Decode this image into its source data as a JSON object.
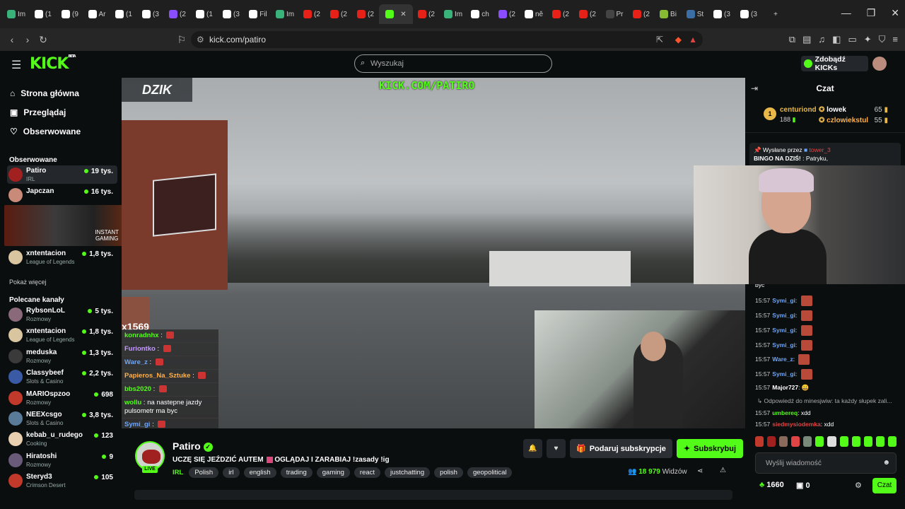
{
  "browser": {
    "tabs": [
      {
        "label": "Im",
        "color": "#3ab37a"
      },
      {
        "label": "(1",
        "color": "#ffffff"
      },
      {
        "label": "(9",
        "color": "#ffffff"
      },
      {
        "label": "Ar",
        "color": "#ffffff"
      },
      {
        "label": "(1",
        "color": "#ffffff"
      },
      {
        "label": "(3",
        "color": "#ffffff"
      },
      {
        "label": "(2",
        "color": "#8a4dff"
      },
      {
        "label": "(1",
        "color": "#ffffff"
      },
      {
        "label": "(3",
        "color": "#ffffff"
      },
      {
        "label": "Fil",
        "color": "#ffffff"
      },
      {
        "label": "Im",
        "color": "#3ab37a"
      },
      {
        "label": "(2",
        "color": "#e62117"
      },
      {
        "label": "(2",
        "color": "#e62117"
      },
      {
        "label": "(2",
        "color": "#e62117"
      },
      {
        "label": "",
        "color": "#53fc18"
      },
      {
        "label": "(2",
        "color": "#e62117"
      },
      {
        "label": "Im",
        "color": "#3ab37a"
      },
      {
        "label": "ch",
        "color": "#ffffff"
      },
      {
        "label": "(2",
        "color": "#8a4dff"
      },
      {
        "label": "ně",
        "color": "#ffffff"
      },
      {
        "label": "(2",
        "color": "#e62117"
      },
      {
        "label": "(2",
        "color": "#e62117"
      },
      {
        "label": "Pr",
        "color": "#444444"
      },
      {
        "label": "(2",
        "color": "#e62117"
      },
      {
        "label": "Bi",
        "color": "#88bb33"
      },
      {
        "label": "St",
        "color": "#3b6ea5"
      },
      {
        "label": "(3",
        "color": "#ffffff"
      },
      {
        "label": "(3",
        "color": "#ffffff"
      }
    ],
    "url": "kick.com/patiro"
  },
  "header": {
    "logo": "KICK",
    "logo_beta": "BETA",
    "search_placeholder": "Wyszukaj",
    "kicks_button": "Zdobądź KICKs"
  },
  "sidebar": {
    "nav": [
      {
        "label": "Strona główna",
        "icon": "⌂"
      },
      {
        "label": "Przeglądaj",
        "icon": "▣"
      },
      {
        "label": "Obserwowane",
        "icon": "♡"
      }
    ],
    "followed_heading": "Obserwowane",
    "followed": [
      {
        "name": "Patiro",
        "category": "IRL",
        "viewers": "19 tys.",
        "avatar": "#a12020"
      },
      {
        "name": "Japczan",
        "category": "",
        "viewers": "16 tys.",
        "avatar": "#c98a7a"
      },
      {
        "name": "xntentacion",
        "category": "League of Legends",
        "viewers": "1,8 tys.",
        "avatar": "#d9c6a0"
      }
    ],
    "ad_text_1": "INSTANT",
    "ad_text_2": "GAMING",
    "show_more": "Pokaż więcej",
    "recommended_heading": "Polecane kanały",
    "recommended": [
      {
        "name": "RybsonLoL",
        "category": "Rozmowy",
        "viewers": "5 tys.",
        "avatar": "#8a6a7a"
      },
      {
        "name": "xntentacion",
        "category": "League of Legends",
        "viewers": "1,8 tys.",
        "avatar": "#d9c6a0"
      },
      {
        "name": "meduska",
        "category": "Rozmowy",
        "viewers": "1,3 tys.",
        "avatar": "#3a3a3a"
      },
      {
        "name": "Classybeef",
        "category": "Slots & Casino",
        "viewers": "2,2 tys.",
        "avatar": "#3b5aa5"
      },
      {
        "name": "MARIOspzoo",
        "category": "Rozmowy",
        "viewers": "698",
        "avatar": "#c0392b"
      },
      {
        "name": "NEEXcsgo",
        "category": "Slots & Casino",
        "viewers": "3,8 tys.",
        "avatar": "#5a7a9a"
      },
      {
        "name": "kebab_u_rudego",
        "category": "Cooking",
        "viewers": "123",
        "avatar": "#e8d0b0"
      },
      {
        "name": "Hiratoshi",
        "category": "Rozmowy",
        "viewers": "9",
        "avatar": "#6a5a7a"
      },
      {
        "name": "Steryd3",
        "category": "Crimson Desert",
        "viewers": "105",
        "avatar": "#c0392b"
      }
    ]
  },
  "video": {
    "logo": "DZIK",
    "overlay_url": "KICK.COM/PATIRO",
    "cam_number": "x1569",
    "chat": [
      {
        "user": "konradnhx",
        "text": "",
        "color": "#53fc18"
      },
      {
        "user": "Furiontko",
        "text": "",
        "color": "#c59bff"
      },
      {
        "user": "Ware_z",
        "text": "",
        "color": "#6aa6ff"
      },
      {
        "user": "Papieros_Na_Sztuke",
        "text": "",
        "color": "#ffb14a"
      },
      {
        "user": "bbs2020",
        "text": "",
        "color": "#53fc18"
      },
      {
        "user": "wollu",
        "text": "na nastepne jazdy pulsometr ma byc",
        "color": "#53fc18"
      },
      {
        "user": "Symi_gi",
        "text": "",
        "color": "#6aa6ff"
      }
    ]
  },
  "stream": {
    "name": "Patiro",
    "live": "LIVE",
    "title_a": "UCZĘ SIĘ JEŹDZIĆ AUTEM",
    "title_b": "OGLĄDAJ I ZARABIAJ !zasady !ig",
    "category": "IRL",
    "tags": [
      "Polish",
      "irl",
      "english",
      "trading",
      "gaming",
      "react",
      "justchatting",
      "polish",
      "geopolitical"
    ],
    "gift_button": "Podaruj subskrypcje",
    "sub_button": "Subskrybuj",
    "viewers_count": "18 979",
    "viewers_label": "Widzów"
  },
  "chat": {
    "title": "Czat",
    "leaderboard": {
      "first_rank": "1",
      "first_name": "centuriond",
      "first_count": "188",
      "others": [
        {
          "name": "lowek",
          "count": "65",
          "color": "#ffffff"
        },
        {
          "name": "czlowiekstul",
          "count": "55",
          "color": "#ffb14a"
        }
      ]
    },
    "pinned_by": "Wysłane przez",
    "pinned_user": "tower_3",
    "pinned_text": "BINGO NA DZIŚ!",
    "pinned_tail": ": Patryku,",
    "partial_line": "byc",
    "messages": [
      {
        "time": "15:57",
        "user": "Symi_gi",
        "color": "#6aa6ff",
        "text": "",
        "emote": true
      },
      {
        "time": "15:57",
        "user": "Symi_gi",
        "color": "#6aa6ff",
        "text": "",
        "emote": true
      },
      {
        "time": "15:57",
        "user": "Symi_gi",
        "color": "#6aa6ff",
        "text": "",
        "emote": true
      },
      {
        "time": "15:57",
        "user": "Symi_gi",
        "color": "#6aa6ff",
        "text": "",
        "emote": true
      },
      {
        "time": "15:57",
        "user": "Ware_z",
        "color": "#6aa6ff",
        "text": "",
        "emote": true
      },
      {
        "time": "15:57",
        "user": "Symi_gi",
        "color": "#6aa6ff",
        "text": "",
        "emote": true
      },
      {
        "time": "15:57",
        "user": "Major727",
        "color": "#ffffff",
        "text": "😀",
        "emote": false
      },
      {
        "time": "",
        "user": "",
        "color": "#aaaaaa",
        "text": "↳ Odpowiedź do minesjwiw: ta każdy słupek zali...",
        "emote": false
      },
      {
        "time": "15:57",
        "user": "umbereq",
        "color": "#53fc18",
        "text": "xdd",
        "emote": false
      },
      {
        "time": "15:57",
        "user": "siedmysiodemka",
        "color": "#e04545",
        "text": "xdd",
        "emote": false
      }
    ],
    "emotes": [
      "#c0392b",
      "#a12020",
      "#8a6a5a",
      "#e04545",
      "#7a8a7a",
      "#53fc18",
      "#dddddd",
      "#53fc18",
      "#53fc18",
      "#53fc18",
      "#53fc18",
      "#53fc18"
    ],
    "input_placeholder": "Wyślij wiadomość",
    "points": "1660",
    "box_count": "0",
    "send_button": "Czat"
  }
}
